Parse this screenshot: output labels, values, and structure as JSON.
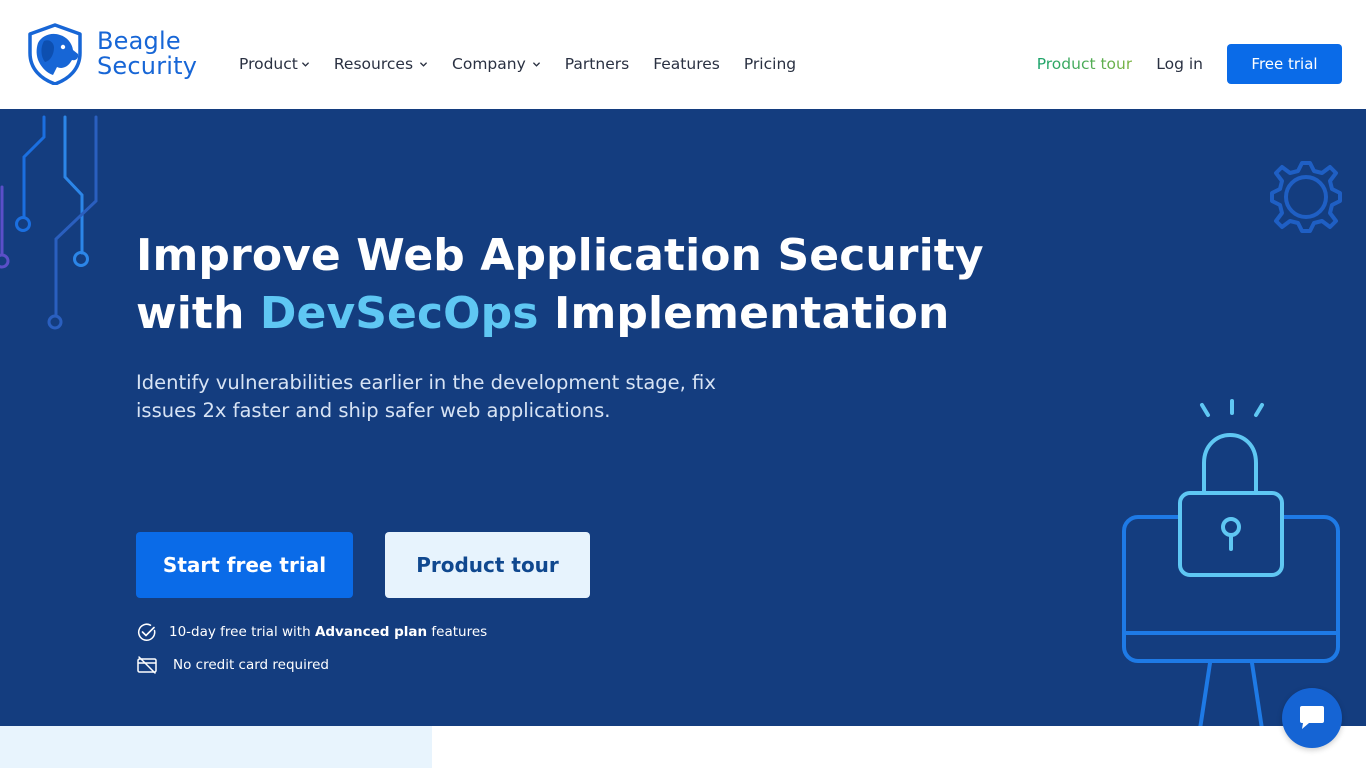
{
  "header": {
    "logo": {
      "line1": "Beagle",
      "line2": "Security",
      "icon": "beagle-dog-logo"
    },
    "nav": [
      {
        "label": "Product",
        "dropdown": true
      },
      {
        "label": "Resources",
        "dropdown": true
      },
      {
        "label": "Company",
        "dropdown": true
      },
      {
        "label": "Partners",
        "dropdown": false
      },
      {
        "label": "Features",
        "dropdown": false
      },
      {
        "label": "Pricing",
        "dropdown": false
      }
    ],
    "product_tour": "Product tour",
    "login": "Log in",
    "free_trial": "Free trial"
  },
  "hero": {
    "title_line1": "Improve Web Application Security",
    "title_with": "with ",
    "title_accent": "DevSecOps",
    "title_rest": " Implementation",
    "subtitle": "Identify vulnerabilities earlier in the development stage, fix issues 2x faster and ship safer web applications.",
    "cta_primary": "Start free trial",
    "cta_secondary": "Product tour",
    "feature1_pre": "10-day free trial with ",
    "feature1_bold": "Advanced plan",
    "feature1_post": " features",
    "feature2": "No credit card required"
  },
  "icons": {
    "circuit": "circuit-decoration-icon",
    "gear": "gear-icon",
    "lock_monitor": "lock-monitor-icon",
    "check": "check-circle-icon",
    "card": "no-credit-card-icon",
    "chat": "chat-bubble-icon",
    "chevron": "chevron-down-icon"
  },
  "colors": {
    "brand_blue": "#0a6be8",
    "hero_bg": "#143d7f",
    "accent_light_blue": "#5fc7f3",
    "tour_green": "#1aa36b"
  }
}
